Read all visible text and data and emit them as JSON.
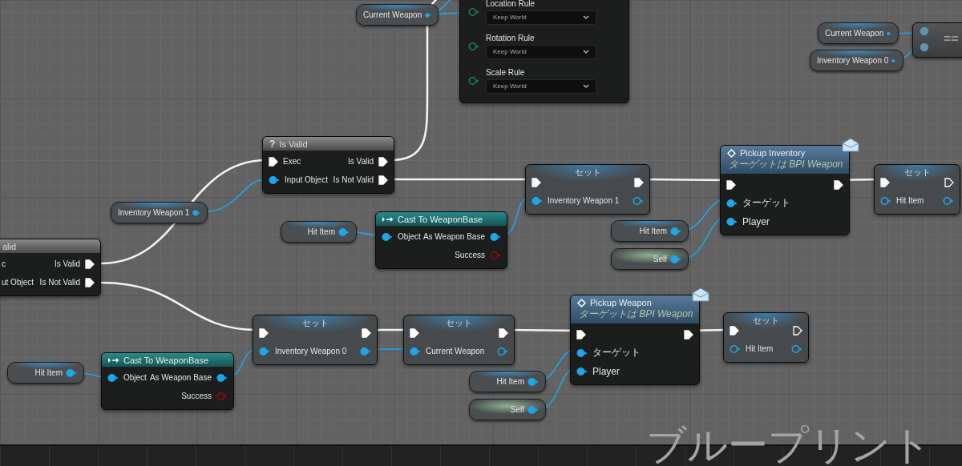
{
  "graph": {
    "nodes": [
      {
        "kind": "variable",
        "label": "Current Weapon",
        "pin": {
          "kind": "object",
          "connected": true
        }
      },
      {
        "kind": "attach",
        "rows": [
          {
            "label": "Location Rule",
            "value": "Keep World",
            "pin": {
              "kind": "enum",
              "connected": false
            }
          },
          {
            "label": "Rotation Rule",
            "value": "Keep World",
            "pin": {
              "kind": "enum",
              "connected": false
            }
          },
          {
            "label": "Scale Rule",
            "value": "Keep World",
            "pin": {
              "kind": "enum",
              "connected": false
            }
          }
        ]
      },
      {
        "kind": "variable",
        "label": "Current Weapon",
        "pin": {
          "kind": "object",
          "connected": true
        }
      },
      {
        "kind": "variable",
        "label": "Inventory Weapon 0",
        "pin": {
          "kind": "object",
          "connected": true
        }
      },
      {
        "kind": "compare",
        "symbol": "==",
        "inputs": [
          {
            "kind": "wildcard",
            "connected": true
          },
          {
            "kind": "wildcard",
            "connected": true
          }
        ]
      },
      {
        "kind": "macro",
        "glyph": "?",
        "title": "Is Valid",
        "inputs": [
          {
            "label": "Exec",
            "kind": "exec",
            "connected": true
          },
          {
            "label": "Input Object",
            "kind": "object",
            "connected": true
          }
        ],
        "outputs": [
          {
            "label": "Is Valid",
            "kind": "exec",
            "connected": true
          },
          {
            "label": "Is Not Valid",
            "kind": "exec",
            "connected": true
          }
        ]
      },
      {
        "kind": "variable",
        "label": "Inventory Weapon 1",
        "pin": {
          "kind": "object",
          "connected": true
        }
      },
      {
        "kind": "set",
        "title": "セット",
        "inputs": [
          {
            "kind": "exec",
            "connected": true
          },
          {
            "label": "Inventory Weapon 1",
            "kind": "object",
            "connected": true
          }
        ],
        "outputs": [
          {
            "kind": "exec",
            "connected": true
          },
          {
            "kind": "object",
            "connected": false
          }
        ]
      },
      {
        "kind": "function",
        "title": "Pickup Inventory",
        "subtitle": "ターゲットは BPI Weapon",
        "message": true,
        "inputs": [
          {
            "kind": "exec",
            "connected": true
          },
          {
            "label": "ターゲット",
            "kind": "object",
            "connected": true
          },
          {
            "label": "Player",
            "kind": "object",
            "connected": true
          }
        ],
        "outputs": [
          {
            "kind": "exec",
            "connected": true
          }
        ]
      },
      {
        "kind": "set",
        "title": "セット",
        "inputs": [
          {
            "kind": "exec",
            "connected": true
          },
          {
            "label": "Hit Item",
            "kind": "object",
            "connected": false
          }
        ],
        "outputs": [
          {
            "kind": "exec",
            "connected": false
          },
          {
            "kind": "object",
            "connected": false
          }
        ]
      },
      {
        "kind": "cast",
        "title": "Cast To WeaponBase",
        "inputs": [
          {
            "label": "Object",
            "kind": "object",
            "connected": true
          }
        ],
        "outputs": [
          {
            "label": "As Weapon Base",
            "kind": "object",
            "connected": true
          },
          {
            "label": "Success",
            "kind": "bool",
            "connected": false
          }
        ]
      },
      {
        "kind": "variable",
        "label": "Hit Item",
        "pin": {
          "kind": "object",
          "connected": true
        }
      },
      {
        "kind": "variable",
        "label": "Hit Item",
        "pin": {
          "kind": "object",
          "connected": true
        }
      },
      {
        "kind": "self",
        "label": "Self",
        "pin": {
          "kind": "object",
          "connected": true
        }
      },
      {
        "kind": "macro",
        "title": "alid",
        "inputs": [
          {
            "label": "c"
          },
          {
            "label": "ut Object"
          }
        ],
        "outputs": [
          {
            "label": "Is Valid",
            "kind": "exec",
            "connected": true
          },
          {
            "label": "Is Not Valid",
            "kind": "exec",
            "connected": true
          }
        ]
      },
      {
        "kind": "set",
        "title": "セット",
        "inputs": [
          {
            "kind": "exec",
            "connected": true
          },
          {
            "label": "Inventory Weapon 0",
            "kind": "object",
            "connected": true
          }
        ],
        "outputs": [
          {
            "kind": "exec",
            "connected": true
          },
          {
            "kind": "object",
            "connected": true
          }
        ]
      },
      {
        "kind": "set",
        "title": "セット",
        "inputs": [
          {
            "kind": "exec",
            "connected": true
          },
          {
            "label": "Current Weapon",
            "kind": "object",
            "connected": true
          }
        ],
        "outputs": [
          {
            "kind": "exec",
            "connected": true
          },
          {
            "kind": "object",
            "connected": false
          }
        ]
      },
      {
        "kind": "function",
        "title": "Pickup Weapon",
        "subtitle": "ターゲットは BPI Weapon",
        "message": true,
        "inputs": [
          {
            "kind": "exec",
            "connected": true
          },
          {
            "label": "ターゲット",
            "kind": "object",
            "connected": true
          },
          {
            "label": "Player",
            "kind": "object",
            "connected": true
          }
        ],
        "outputs": [
          {
            "kind": "exec",
            "connected": true
          }
        ]
      },
      {
        "kind": "set",
        "title": "セット",
        "inputs": [
          {
            "kind": "exec",
            "connected": true
          },
          {
            "label": "Hit Item",
            "kind": "object",
            "connected": false
          }
        ],
        "outputs": [
          {
            "kind": "exec",
            "connected": false
          },
          {
            "kind": "object",
            "connected": false
          }
        ]
      },
      {
        "kind": "variable",
        "label": "Hit Item",
        "pin": {
          "kind": "object",
          "connected": true
        }
      },
      {
        "kind": "cast",
        "title": "Cast To WeaponBase",
        "inputs": [
          {
            "label": "Object",
            "kind": "object",
            "connected": true
          }
        ],
        "outputs": [
          {
            "label": "As Weapon Base",
            "kind": "object",
            "connected": true
          },
          {
            "label": "Success",
            "kind": "bool",
            "connected": false
          }
        ]
      },
      {
        "kind": "variable",
        "label": "Hit Item",
        "pin": {
          "kind": "object",
          "connected": true
        }
      },
      {
        "kind": "self",
        "label": "Self",
        "pin": {
          "kind": "object",
          "connected": true
        }
      }
    ]
  },
  "watermark": "ブループリント"
}
